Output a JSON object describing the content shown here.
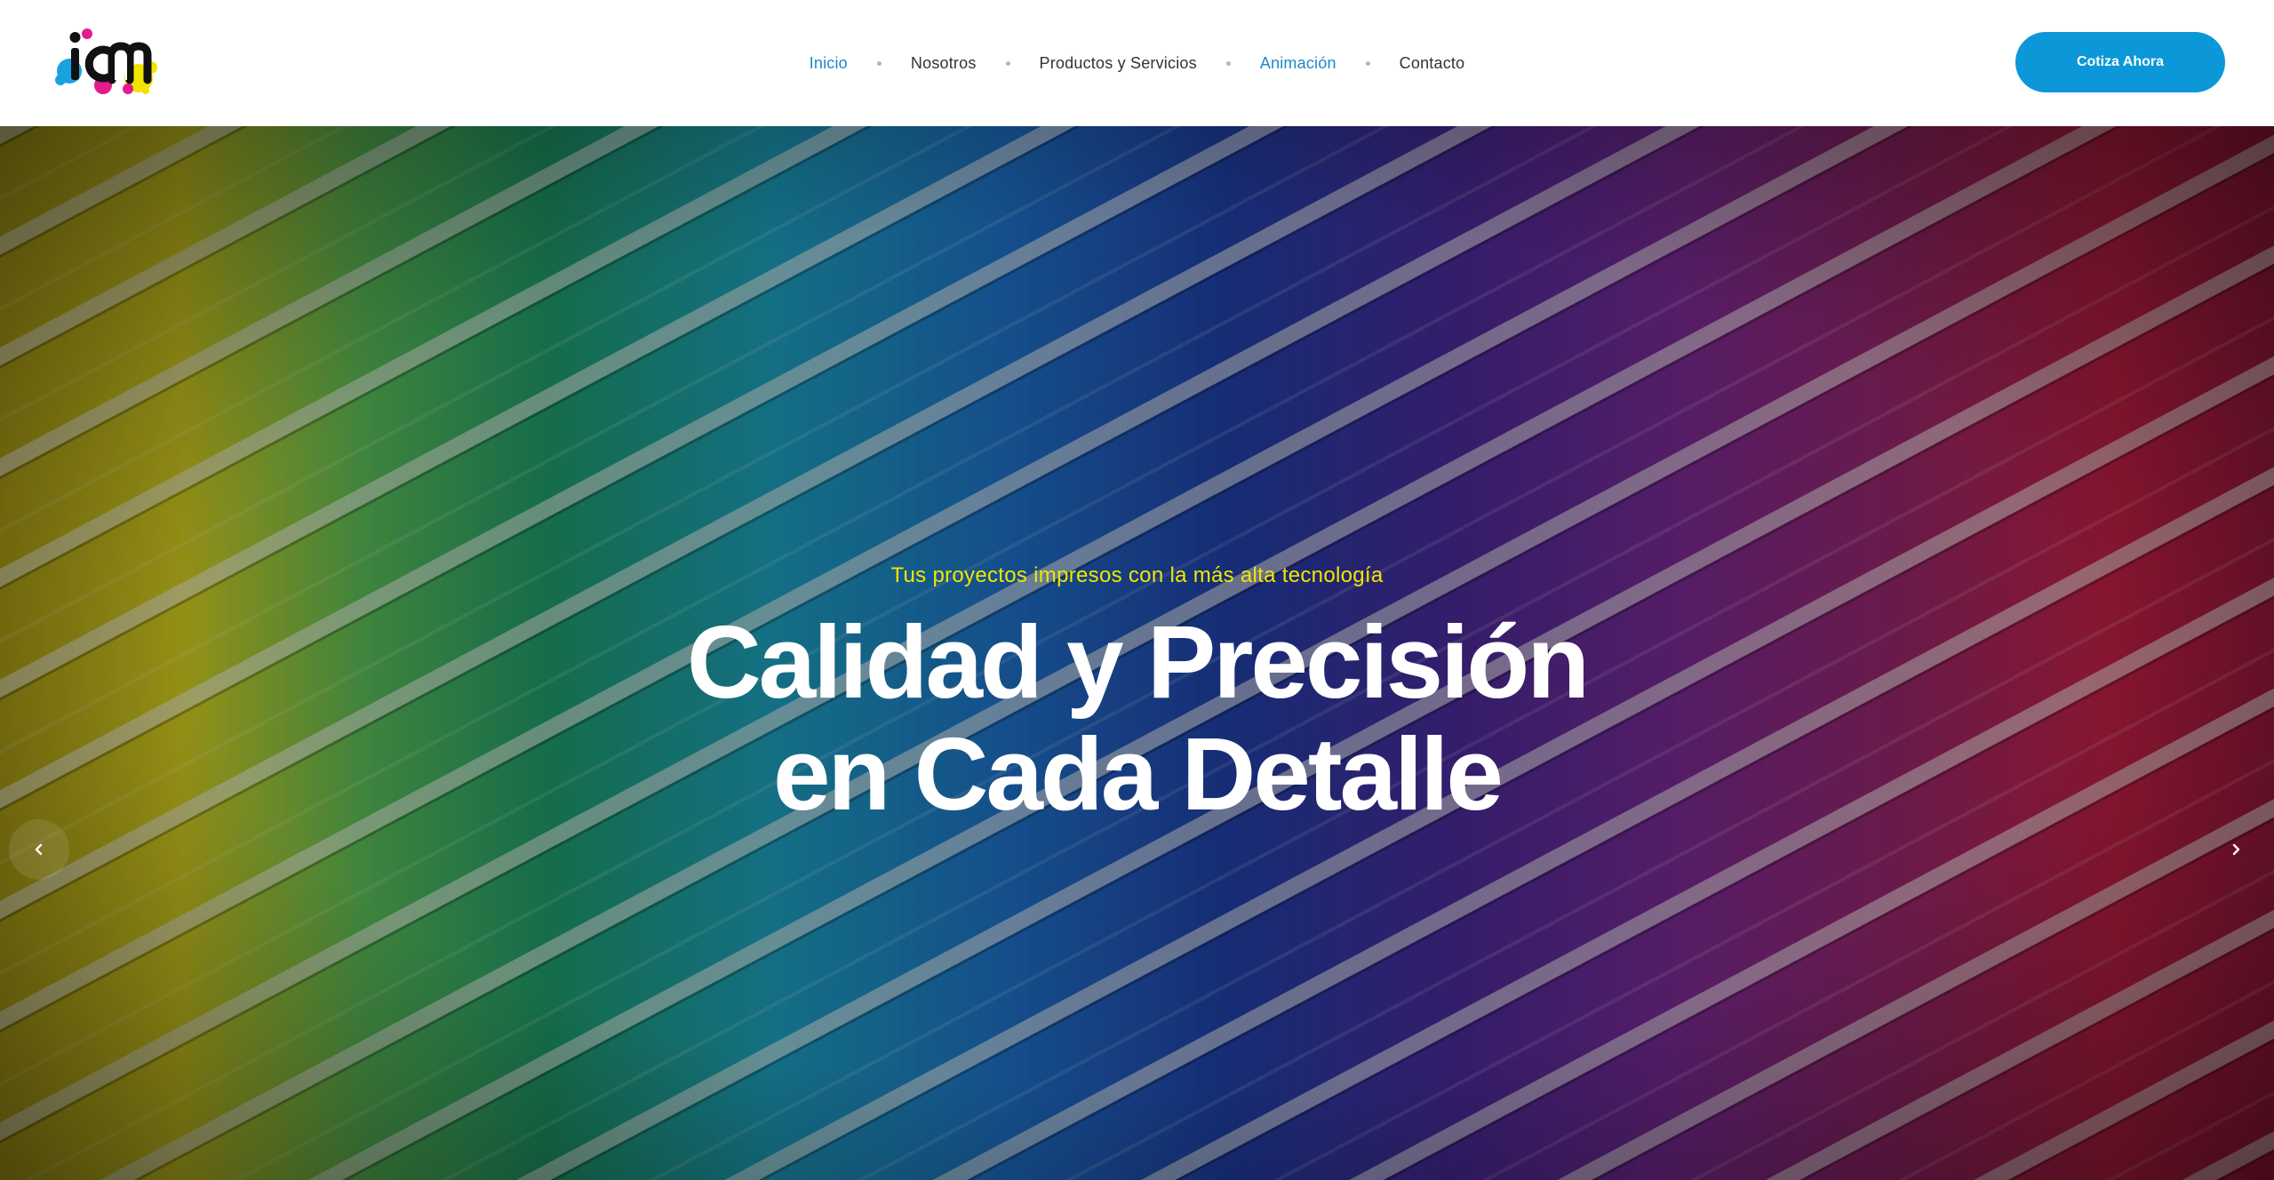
{
  "header": {
    "logo_text": "icm",
    "nav": [
      {
        "label": "Inicio",
        "active": true
      },
      {
        "label": "Nosotros",
        "active": false
      },
      {
        "label": "Productos y Servicios",
        "active": false
      },
      {
        "label": "Animación",
        "active": true
      },
      {
        "label": "Contacto",
        "active": false
      }
    ],
    "cta_label": "Cotiza Ahora"
  },
  "hero": {
    "subtitle": "Tus proyectos impresos con la más alta tecnología",
    "title_line1": "Calidad y Precisión",
    "title_line2": "en Cada Detalle",
    "prev_icon": "chevron-left-icon",
    "next_icon": "chevron-right-icon"
  },
  "colors": {
    "accent": "#0c97d8",
    "nav_active": "#1e88c7",
    "subtitle": "#f2e600"
  }
}
